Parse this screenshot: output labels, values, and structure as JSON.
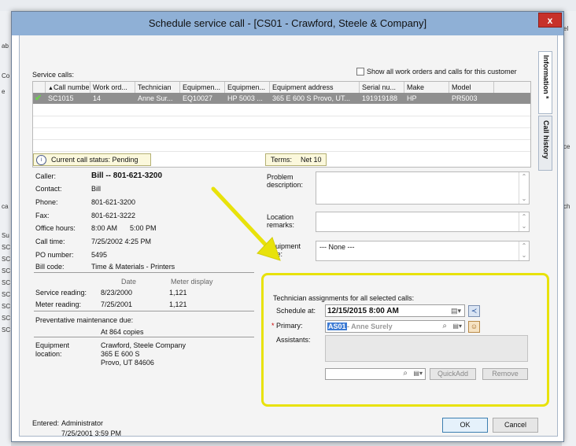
{
  "dialog": {
    "title": "Schedule service call - [CS01 - Crawford, Steele & Company]",
    "close_label": "x"
  },
  "service_calls": {
    "label": "Service calls:",
    "show_all_label": "Show all work orders and calls for this customer",
    "columns": [
      "Call number",
      "Work ord...",
      "Technician",
      "Equipmen...",
      "Equipmen...",
      "Equipment address",
      "Serial nu...",
      "Make",
      "Model"
    ],
    "rows": [
      {
        "call_number": "SC1015",
        "work_order": "14",
        "technician": "Anne Sur...",
        "equipment_id": "EQ10027",
        "equipment_desc": "HP 5003 ...",
        "address": "365 E 600 S Provo, UT...",
        "serial": "191919188",
        "make": "HP",
        "model": "PR5003"
      }
    ]
  },
  "status": {
    "label": "Current call status: Pending"
  },
  "terms": {
    "label": "Terms:",
    "value": "Net 10"
  },
  "caller": {
    "caller_label": "Caller:",
    "caller_value": "Bill -- 801-621-3200",
    "contact_label": "Contact:",
    "contact_value": "Bill",
    "phone_label": "Phone:",
    "phone_value": "801-621-3200",
    "fax_label": "Fax:",
    "fax_value": "801-621-3222",
    "office_label": "Office hours:",
    "office_start": "8:00 AM",
    "office_end": "5:00 PM",
    "calltime_label": "Call time:",
    "calltime_value": "7/25/2002 4:25 PM",
    "po_label": "PO number:",
    "po_value": "5495",
    "bill_label": "Bill code:",
    "bill_value": "Time & Materials - Printers"
  },
  "readings": {
    "date_header": "Date",
    "meter_header": "Meter display",
    "service_label": "Service reading:",
    "service_date": "8/23/2000",
    "service_meter": "1,121",
    "meter_label": "Meter reading:",
    "meter_date": "7/25/2001",
    "meter_meter": "1,121"
  },
  "maintenance": {
    "label": "Preventative maintenance due:",
    "value": "At 864 copies"
  },
  "equipment_location": {
    "label_1": "Equipment",
    "label_2": "location:",
    "line1": "Crawford, Steele  Company",
    "line2": "365 E 600 S",
    "line3": "Provo, UT 84606"
  },
  "notes": {
    "problem_label_1": "Problem",
    "problem_label_2": "description:",
    "location_label_1": "Location",
    "location_label_2": "remarks:",
    "equipment_label_1": "Equipment",
    "equipment_label_2": "note:",
    "equipment_value": "--- None ---"
  },
  "technician": {
    "heading": "Technician assignments for all selected calls:",
    "schedule_label": "Schedule at:",
    "schedule_value": "12/15/2015  8:00 AM",
    "primary_label": "Primary:",
    "primary_required": "*",
    "primary_code": "AS01",
    "primary_name": " - Anne Surely",
    "assistants_label": "Assistants:",
    "quickadd_label": "QuickAdd",
    "remove_label": "Remove"
  },
  "tabs": {
    "information": "Information *",
    "call_history": "Call history"
  },
  "footer": {
    "entered_label": "Entered:",
    "entered_by": "Administrator",
    "entered_date": "7/25/2001 3:59 PM",
    "ok_label": "OK",
    "cancel_label": "Cancel"
  },
  "background": {
    "left_fragments": [
      "ab",
      "Co",
      "e",
      "ca",
      "Su",
      "SC",
      "SC",
      "SC",
      "SC",
      "SC",
      "SC",
      "SC",
      "SC"
    ],
    "right_fragments": [
      "el",
      "ce",
      "ch"
    ]
  },
  "colors": {
    "highlight": "#e8e20b",
    "title_bar": "#8fb0d6",
    "selected_row": "#8f8f8f",
    "close": "#c7312a"
  }
}
